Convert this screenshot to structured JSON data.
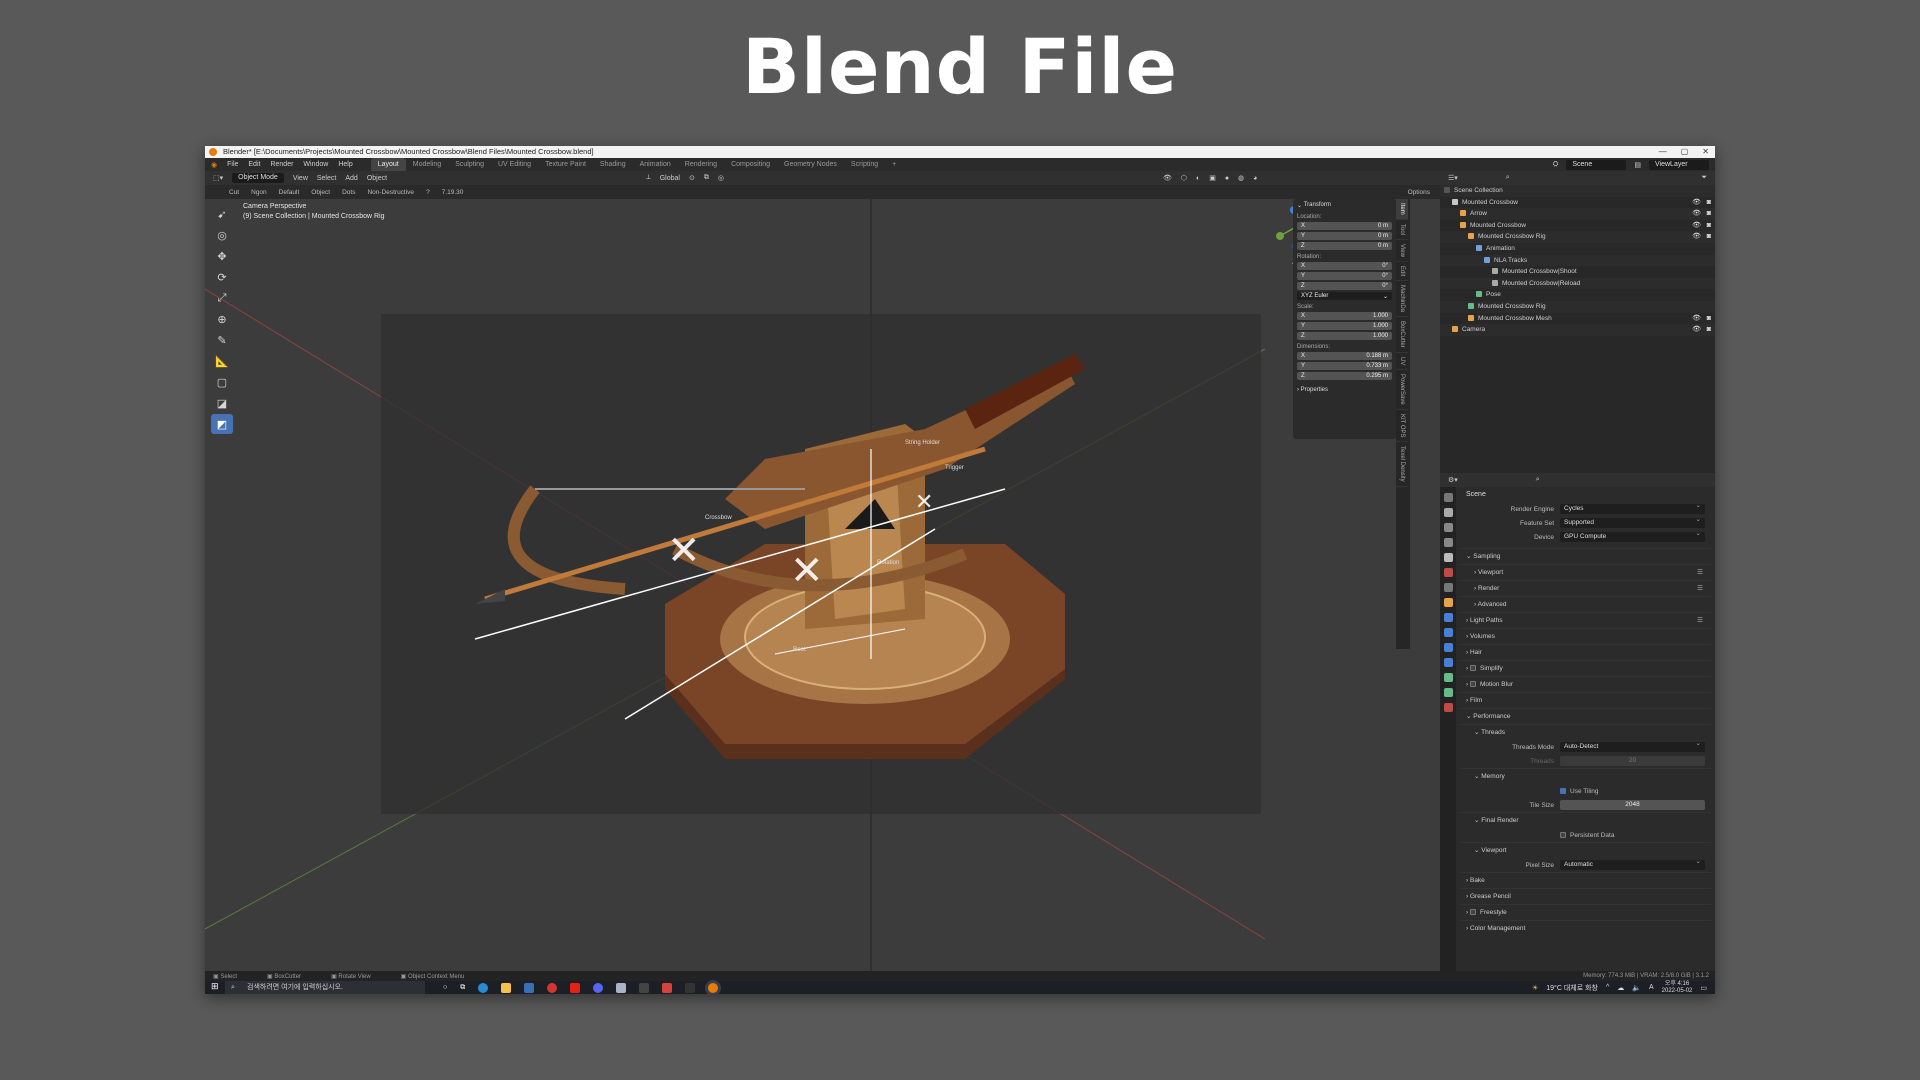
{
  "slide": {
    "title": "Blend File"
  },
  "window": {
    "title": "Blender* [E:\\Documents\\Projects\\Mounted Crossbow\\Mounted Crossbow\\Blend Files\\Mounted Crossbow.blend]"
  },
  "menu": [
    "File",
    "Edit",
    "Render",
    "Window",
    "Help"
  ],
  "workspaces": [
    "Layout",
    "Modeling",
    "Sculpting",
    "UV Editing",
    "Texture Paint",
    "Shading",
    "Animation",
    "Rendering",
    "Compositing",
    "Geometry Nodes",
    "Scripting",
    "+"
  ],
  "scene": {
    "name": "Scene",
    "view_layer": "ViewLayer"
  },
  "vp_header": {
    "mode": "Object Mode",
    "view": "View",
    "select": "Select",
    "add": "Add",
    "object": "Object",
    "orientation": "Global"
  },
  "tool_header": {
    "cut": "Cut",
    "ngon": "Ngon",
    "default": "Default",
    "object": "Object",
    "dots": "Dots",
    "non_destructive": "Non-Destructive",
    "version": "7.19.30",
    "options": "Options"
  },
  "viewport_info": {
    "line1": "Camera Perspective",
    "line2": "(9) Scene Collection | Mounted Crossbow Rig"
  },
  "bone_labels": {
    "string_holder": "String Holder",
    "trigger": "Trigger",
    "crossbow": "Crossbow",
    "rotation": "Rotation",
    "root": "Root"
  },
  "npanel": {
    "header": "Transform",
    "location_label": "Location:",
    "location": [
      {
        "axis": "X",
        "value": "0 m"
      },
      {
        "axis": "Y",
        "value": "0 m"
      },
      {
        "axis": "Z",
        "value": "0 m"
      }
    ],
    "rotation_label": "Rotation:",
    "rotation": [
      {
        "axis": "X",
        "value": "0°"
      },
      {
        "axis": "Y",
        "value": "0°"
      },
      {
        "axis": "Z",
        "value": "0°"
      }
    ],
    "rotation_mode": "XYZ Euler",
    "scale_label": "Scale:",
    "scale": [
      {
        "axis": "X",
        "value": "1.000"
      },
      {
        "axis": "Y",
        "value": "1.000"
      },
      {
        "axis": "Z",
        "value": "1.000"
      }
    ],
    "dimensions_label": "Dimensions:",
    "dimensions": [
      {
        "axis": "X",
        "value": "0.188 m"
      },
      {
        "axis": "Y",
        "value": "0.733 m"
      },
      {
        "axis": "Z",
        "value": "0.295 m"
      }
    ],
    "properties": "Properties",
    "tabs": [
      "Item",
      "Tool",
      "View",
      "Edit",
      "MachinDa",
      "BoxCutter",
      "UV",
      "PowerSave",
      "KIT OPS",
      "Texel Density"
    ]
  },
  "outliner": {
    "rows": [
      {
        "label": "Scene Collection",
        "indent": 0
      },
      {
        "label": "Mounted Crossbow",
        "indent": 1,
        "color": "#c8c8c8"
      },
      {
        "label": "Arrow",
        "indent": 2,
        "color": "#e8a24a"
      },
      {
        "label": "Mounted Crossbow",
        "indent": 2,
        "color": "#e8a24a"
      },
      {
        "label": "Mounted Crossbow Rig",
        "indent": 3,
        "color": "#e8a24a"
      },
      {
        "label": "Animation",
        "indent": 4,
        "color": "#6fa0d8"
      },
      {
        "label": "NLA Tracks",
        "indent": 5,
        "color": "#6fa0d8"
      },
      {
        "label": "Mounted Crossbow|Shoot",
        "indent": 6,
        "color": "#aaaaaa"
      },
      {
        "label": "Mounted Crossbow|Reload",
        "indent": 6,
        "color": "#aaaaaa"
      },
      {
        "label": "Pose",
        "indent": 4,
        "color": "#66bb88"
      },
      {
        "label": "Mounted Crossbow Rig",
        "indent": 3,
        "color": "#66bb88"
      },
      {
        "label": "Mounted Crossbow Mesh",
        "indent": 3,
        "color": "#e8a24a"
      },
      {
        "label": "Camera",
        "indent": 1,
        "color": "#e8a24a"
      }
    ]
  },
  "properties": {
    "scene_label": "Scene",
    "render_engine": {
      "label": "Render Engine",
      "value": "Cycles"
    },
    "feature_set": {
      "label": "Feature Set",
      "value": "Supported"
    },
    "device": {
      "label": "Device",
      "value": "GPU Compute"
    },
    "sections": {
      "sampling": "Sampling",
      "viewport": "Viewport",
      "render": "Render",
      "advanced": "Advanced",
      "light_paths": "Light Paths",
      "volumes": "Volumes",
      "hair": "Hair",
      "simplify": "Simplify",
      "motion_blur": "Motion Blur",
      "film": "Film",
      "performance": "Performance",
      "threads": "Threads",
      "memory": "Memory",
      "final_render": "Final Render",
      "viewport2": "Viewport",
      "bake": "Bake",
      "grease_pencil": "Grease Pencil",
      "freestyle": "Freestyle",
      "color_management": "Color Management"
    },
    "threads_mode": {
      "label": "Threads Mode",
      "value": "Auto-Detect"
    },
    "threads": {
      "label": "Threads",
      "value": "20"
    },
    "use_tiling": "Use Tiling",
    "tile_size": {
      "label": "Tile Size",
      "value": "2048"
    },
    "persistent_data": "Persistent Data",
    "pixel_size": {
      "label": "Pixel Size",
      "value": "Automatic"
    }
  },
  "statusbar": {
    "select": "Select",
    "boxcutter": "BoxCutter",
    "rotate": "Rotate View",
    "context": "Object Context Menu",
    "memory": "Memory: 774.3 MiB | VRAM: 2.5/8.0 GiB | 3.1.2"
  },
  "taskbar": {
    "search_placeholder": "검색하려면 여기에 입력하십시오.",
    "weather": "19°C 대체로 화창",
    "time": "오후 4:16",
    "date": "2022-05-02",
    "lang": "A"
  },
  "colors": {
    "accent": "#4772b3",
    "blender_orange": "#e87d0d",
    "slide_bg": "#595959"
  }
}
